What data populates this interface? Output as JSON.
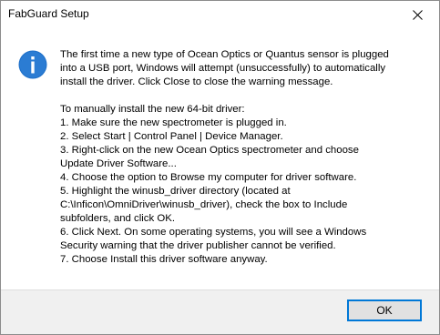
{
  "window": {
    "title": "FabGuard Setup",
    "close_icon": "close-icon"
  },
  "message": {
    "icon": "info-icon",
    "paragraph1": [
      "The first time a new type of Ocean Optics or Quantus sensor is plugged",
      "into a USB port, Windows will attempt (unsuccessfully) to automatically",
      "install the driver. Click Close to close the warning message."
    ],
    "paragraph2": [
      "To manually install the new 64-bit driver:",
      "1. Make sure the new spectrometer is plugged in.",
      "2. Select Start | Control Panel | Device Manager.",
      "3. Right-click on the new Ocean Optics spectrometer and choose",
      "Update Driver Software...",
      "4. Choose the option to Browse my computer for driver software.",
      "5. Highlight the winusb_driver directory (located at",
      "C:\\Inficon\\OmniDriver\\winusb_driver), check the box to Include",
      "subfolders, and click OK.",
      "6. Click Next. On some operating systems, you will see a Windows",
      "Security warning that the driver publisher cannot be verified.",
      "7. Choose Install this driver software anyway."
    ]
  },
  "footer": {
    "ok_label": "OK"
  },
  "colors": {
    "accent": "#0078d7",
    "footer_bg": "#f0f0f0",
    "button_bg": "#e1e1e1"
  }
}
